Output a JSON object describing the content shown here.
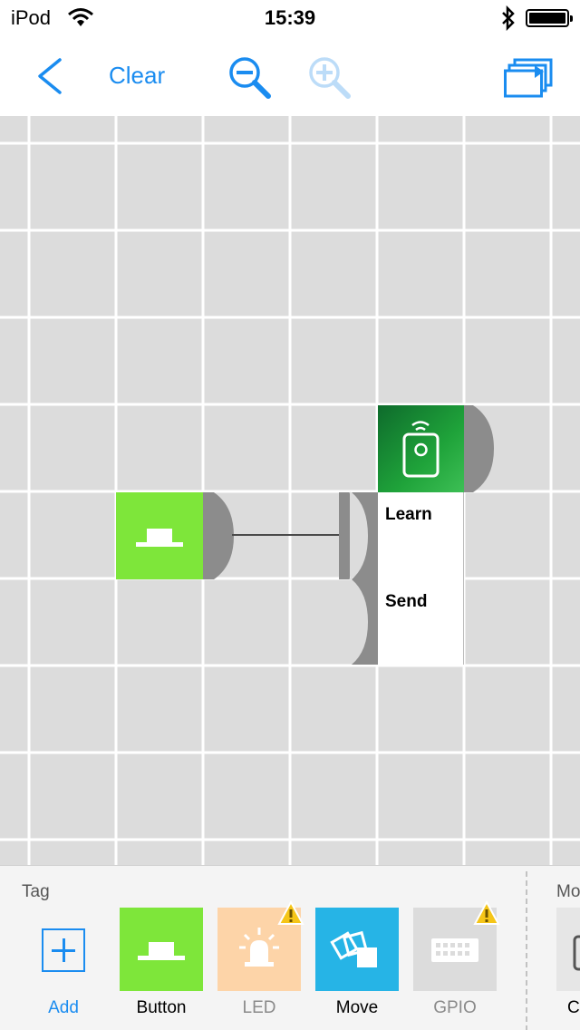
{
  "status_bar": {
    "carrier": "iPod",
    "time": "15:39"
  },
  "nav": {
    "clear_label": "Clear"
  },
  "canvas": {
    "blocks": {
      "remote": {
        "learn_label": "Learn",
        "send_label": "Send"
      }
    }
  },
  "palette": {
    "section_title": "Tag",
    "next_section_title": "Mo",
    "items": [
      {
        "label": "Add",
        "icon": "plus-icon",
        "color": "#1a8cf0"
      },
      {
        "label": "Button",
        "icon": "push-button-icon",
        "color": "#7ee63a"
      },
      {
        "label": "LED",
        "icon": "siren-light-icon",
        "color": "#fdd4a8",
        "warning": true
      },
      {
        "label": "Move",
        "icon": "move-cards-icon",
        "color": "#26b4e6"
      },
      {
        "label": "GPIO",
        "icon": "keyboard-icon",
        "color": "#dcdcdc",
        "warning": true
      }
    ],
    "partial_item_label": "C"
  },
  "colors": {
    "accent": "#1a8cf0",
    "canvas": "#dcdcdc",
    "button_block": "#7ee63a",
    "remote_block": "#1fa33a",
    "connector": "#8c8c8c"
  }
}
